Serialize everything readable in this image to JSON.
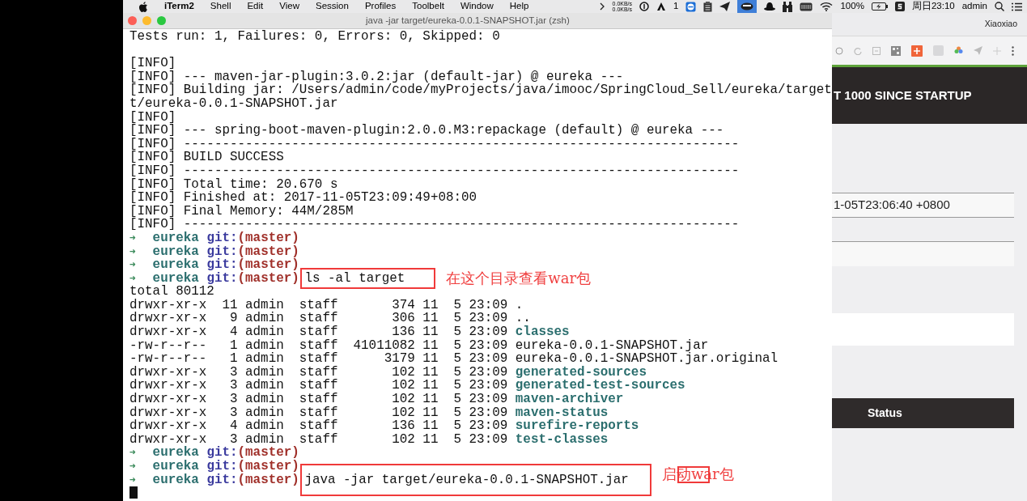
{
  "menu_bar": {
    "app_name": "iTerm2",
    "menus": [
      "Shell",
      "Edit",
      "View",
      "Session",
      "Profiles",
      "Toolbelt",
      "Window",
      "Help"
    ],
    "status": {
      "upload_rate": "0.0KB/s",
      "download_rate": "0.0KB/s",
      "badge_count": "1",
      "battery": "100%",
      "clock": "周日23:10",
      "user": "admin"
    }
  },
  "terminal": {
    "title": "java -jar target/eureka-0.0.1-SNAPSHOT.jar (zsh)",
    "lines": [
      {
        "kind": "output",
        "text": "Tests run: 1, Failures: 0, Errors: 0, Skipped: 0"
      },
      {
        "kind": "blank"
      },
      {
        "kind": "output",
        "text": "[INFO]"
      },
      {
        "kind": "output",
        "text": "[INFO] --- maven-jar-plugin:3.0.2:jar (default-jar) @ eureka ---"
      },
      {
        "kind": "output",
        "text": "[INFO] Building jar: /Users/admin/code/myProjects/java/imooc/SpringCloud_Sell/eureka/target"
      },
      {
        "kind": "output",
        "text": "t/eureka-0.0.1-SNAPSHOT.jar"
      },
      {
        "kind": "output",
        "text": "[INFO]"
      },
      {
        "kind": "output",
        "text": "[INFO] --- spring-boot-maven-plugin:2.0.0.M3:repackage (default) @ eureka ---"
      },
      {
        "kind": "output",
        "text": "[INFO] ------------------------------------------------------------------------"
      },
      {
        "kind": "output",
        "text": "[INFO] BUILD SUCCESS"
      },
      {
        "kind": "output",
        "text": "[INFO] ------------------------------------------------------------------------"
      },
      {
        "kind": "output",
        "text": "[INFO] Total time: 20.670 s"
      },
      {
        "kind": "output",
        "text": "[INFO] Finished at: 2017-11-05T23:09:49+08:00"
      },
      {
        "kind": "output",
        "text": "[INFO] Final Memory: 44M/285M"
      },
      {
        "kind": "output",
        "text": "[INFO] ------------------------------------------------------------------------"
      },
      {
        "kind": "prompt",
        "arrow": "➜",
        "dir": "eureka",
        "vcs": "git:",
        "branch": "(master)"
      },
      {
        "kind": "prompt",
        "arrow": "➜",
        "dir": "eureka",
        "vcs": "git:",
        "branch": "(master)"
      },
      {
        "kind": "prompt",
        "arrow": "➜",
        "dir": "eureka",
        "vcs": "git:",
        "branch": "(master)"
      },
      {
        "kind": "prompt",
        "arrow": "➜",
        "dir": "eureka",
        "vcs": "git:",
        "branch": "(master)",
        "command": "ls -al target",
        "annotation": "在这个目录查看war包",
        "annotation_box": false
      },
      {
        "kind": "output",
        "text": "total 80112"
      },
      {
        "kind": "listing",
        "entry": "drwxr-xr-x  11 admin  staff       374 11  5 23:09",
        "name": ".",
        "colored": false
      },
      {
        "kind": "listing",
        "entry": "drwxr-xr-x   9 admin  staff       306 11  5 23:09",
        "name": "..",
        "colored": false
      },
      {
        "kind": "listing",
        "entry": "drwxr-xr-x   4 admin  staff       136 11  5 23:09",
        "name": "classes",
        "colored": true
      },
      {
        "kind": "listing",
        "entry": "-rw-r--r--   1 admin  staff  41011082 11  5 23:09",
        "name": "eureka-0.0.1-SNAPSHOT.jar",
        "colored": false
      },
      {
        "kind": "listing",
        "entry": "-rw-r--r--   1 admin  staff      3179 11  5 23:09",
        "name": "eureka-0.0.1-SNAPSHOT.jar.original",
        "colored": false
      },
      {
        "kind": "listing",
        "entry": "drwxr-xr-x   3 admin  staff       102 11  5 23:09",
        "name": "generated-sources",
        "colored": true
      },
      {
        "kind": "listing",
        "entry": "drwxr-xr-x   3 admin  staff       102 11  5 23:09",
        "name": "generated-test-sources",
        "colored": true
      },
      {
        "kind": "listing",
        "entry": "drwxr-xr-x   3 admin  staff       102 11  5 23:09",
        "name": "maven-archiver",
        "colored": true
      },
      {
        "kind": "listing",
        "entry": "drwxr-xr-x   3 admin  staff       102 11  5 23:09",
        "name": "maven-status",
        "colored": true
      },
      {
        "kind": "listing",
        "entry": "drwxr-xr-x   4 admin  staff       136 11  5 23:09",
        "name": "surefire-reports",
        "colored": true
      },
      {
        "kind": "listing",
        "entry": "drwxr-xr-x   3 admin  staff       102 11  5 23:09",
        "name": "test-classes",
        "colored": true
      },
      {
        "kind": "prompt",
        "arrow": "➜",
        "dir": "eureka",
        "vcs": "git:",
        "branch": "(master)"
      },
      {
        "kind": "prompt",
        "arrow": "➜",
        "dir": "eureka",
        "vcs": "git:",
        "branch": "(master)"
      },
      {
        "kind": "prompt",
        "arrow": "➜",
        "dir": "eureka",
        "vcs": "git:",
        "branch": "(master)",
        "command": "java -jar target/eureka-0.0.1-SNAPSHOT.jar",
        "annotation": "启动war包",
        "annotation_box": true
      },
      {
        "kind": "cursor"
      }
    ]
  },
  "browser": {
    "profile": "Xiaoxiao",
    "header": "T 1000 SINCE STARTUP",
    "timestamp": "1-05T23:06:40 +0800",
    "status_label": "Status"
  }
}
